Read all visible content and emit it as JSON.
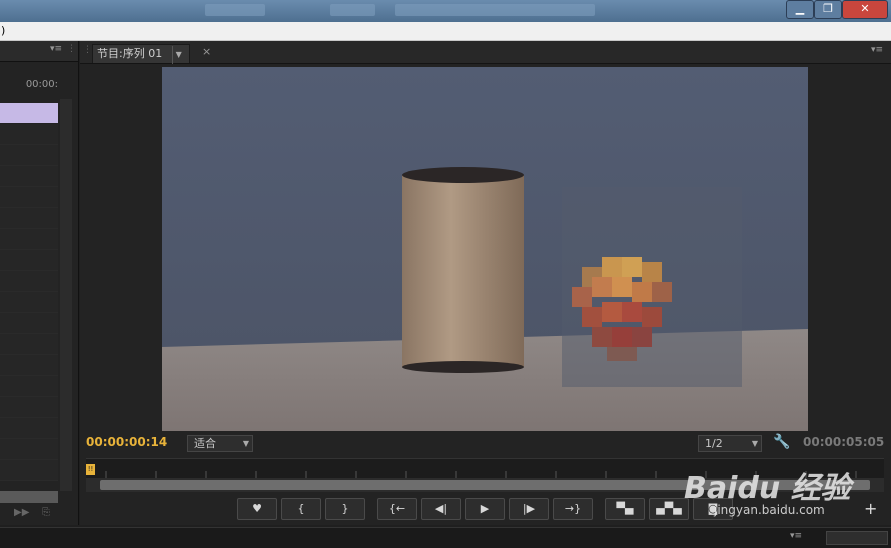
{
  "menubar": {
    "fragment": ")"
  },
  "left_panel": {
    "time_label": "00:00:"
  },
  "monitor": {
    "tab_label": "节目:序列 01",
    "tab_close": "×",
    "current_time": "00:00:00:14",
    "fit_dropdown": "适合",
    "resolution_dropdown": "1/2",
    "duration": "00:00:05:05",
    "playhead_marker": "!!"
  },
  "controls": {
    "marker": "♥",
    "in_point": "{",
    "out_point": "}",
    "go_to_in": "{←",
    "step_back": "◀|",
    "play": "▶",
    "step_forward": "|▶",
    "go_to_out": "→}",
    "add": "+"
  },
  "watermark": {
    "brand": "Baidu 经验",
    "url": "jingyan.baidu.com"
  },
  "colors": {
    "accent_timecode": "#e8b33a",
    "selected_track": "#c6b9e6",
    "panel_bg": "#232323"
  }
}
